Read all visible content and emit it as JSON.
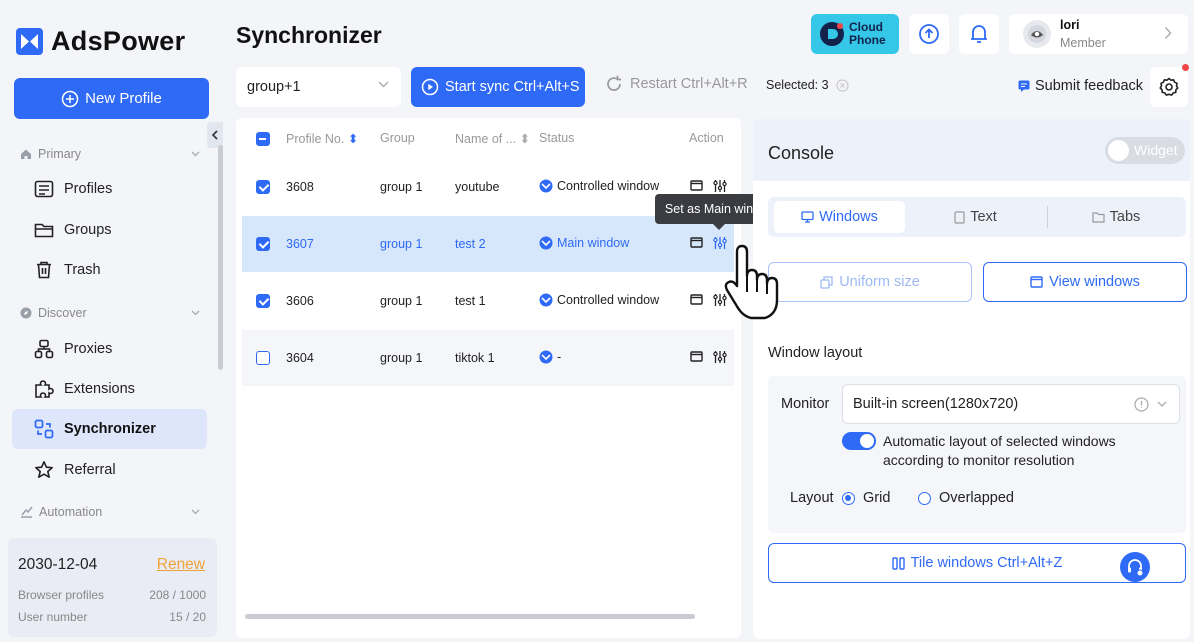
{
  "app": {
    "logo_text": "AdsPower",
    "accent": "#2e6af5"
  },
  "sidebar": {
    "new_profile": "New Profile",
    "sections": [
      {
        "label": "Primary"
      },
      {
        "label": "Discover"
      },
      {
        "label": "Automation"
      }
    ],
    "items": [
      {
        "label": "Profiles",
        "icon": "profiles-icon"
      },
      {
        "label": "Groups",
        "icon": "folder-icon"
      },
      {
        "label": "Trash",
        "icon": "trash-icon"
      },
      {
        "label": "Proxies",
        "icon": "proxies-icon"
      },
      {
        "label": "Extensions",
        "icon": "puzzle-icon"
      },
      {
        "label": "Synchronizer",
        "icon": "synchronizer-icon",
        "active": true
      },
      {
        "label": "Referral",
        "icon": "star-icon"
      }
    ],
    "plan": {
      "date": "2030-12-04",
      "renew": "Renew",
      "browser_profiles_label": "Browser profiles",
      "browser_profiles_value": "208 / 1000",
      "user_number_label": "User number",
      "user_number_value": "15 / 20"
    }
  },
  "header": {
    "title": "Synchronizer",
    "cloud_phone_line1": "Cloud",
    "cloud_phone_line2": "Phone",
    "user": {
      "name": "lori",
      "role": "Member"
    }
  },
  "toolbar": {
    "group_value": "group+1",
    "start_sync": "Start sync Ctrl+Alt+S",
    "restart": "Restart Ctrl+Alt+R",
    "selected": "Selected: 3",
    "feedback": "Submit feedback"
  },
  "table": {
    "headers": {
      "profile_no": "Profile No.",
      "group": "Group",
      "name": "Name of ...",
      "status": "Status",
      "action": "Action"
    },
    "rows": [
      {
        "no": "3608",
        "group": "group 1",
        "name": "youtube",
        "status": "Controlled window",
        "checked": true
      },
      {
        "no": "3607",
        "group": "group 1",
        "name": "test 2",
        "status": "Main window",
        "checked": true
      },
      {
        "no": "3606",
        "group": "group 1",
        "name": "test 1",
        "status": "Controlled window",
        "checked": true
      },
      {
        "no": "3604",
        "group": "group 1",
        "name": "tiktok 1",
        "status": "-",
        "checked": false
      }
    ],
    "tooltip": "Set as Main window"
  },
  "console": {
    "title": "Console",
    "widget": "Widget",
    "tabs": [
      {
        "label": "Windows",
        "active": true
      },
      {
        "label": "Text"
      },
      {
        "label": "Tabs"
      }
    ],
    "uniform_size": "Uniform size",
    "view_windows": "View windows",
    "window_layout": "Window layout",
    "monitor_label": "Monitor",
    "monitor_value": "Built-in screen(1280x720)",
    "auto_layout_line1": "Automatic layout of selected windows",
    "auto_layout_line2": "according to monitor resolution",
    "layout_label": "Layout",
    "layout_grid": "Grid",
    "layout_overlapped": "Overlapped",
    "tile_windows": "Tile windows Ctrl+Alt+Z"
  }
}
